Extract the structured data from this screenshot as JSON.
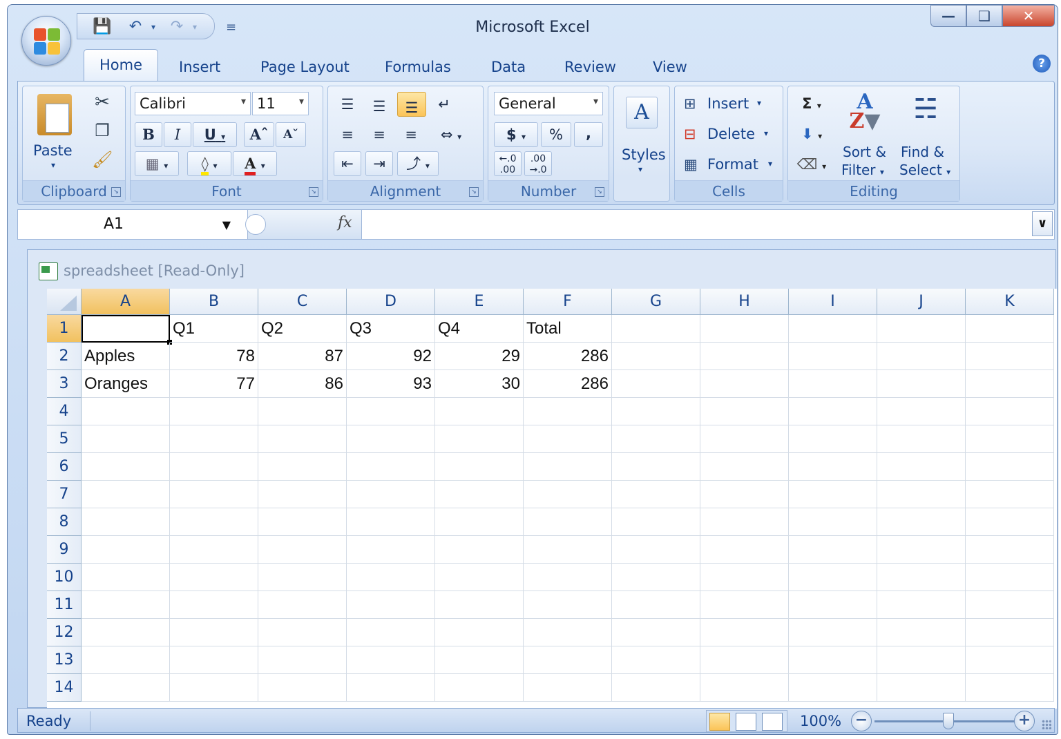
{
  "window": {
    "title": "Microsoft Excel"
  },
  "ribbon_tabs": [
    "Home",
    "Insert",
    "Page Layout",
    "Formulas",
    "Data",
    "Review",
    "View"
  ],
  "ribbon": {
    "clipboard": {
      "label": "Clipboard",
      "paste": "Paste"
    },
    "font": {
      "label": "Font",
      "name": "Calibri",
      "size": "11"
    },
    "alignment": {
      "label": "Alignment"
    },
    "number": {
      "label": "Number",
      "format": "General",
      "currency": "$",
      "percent": "%",
      "comma": ",",
      "inc_decimal": ".00",
      "dec_decimal": ".0"
    },
    "styles": {
      "label": "Styles"
    },
    "cells": {
      "label": "Cells",
      "insert": "Insert",
      "delete": "Delete",
      "format": "Format"
    },
    "editing": {
      "label": "Editing",
      "sort_line1": "Sort &",
      "sort_line2": "Filter",
      "find_line1": "Find &",
      "find_line2": "Select"
    }
  },
  "formula_bar": {
    "name_box": "A1",
    "fx": "fx",
    "value": ""
  },
  "workbook": {
    "title": "spreadsheet  [Read-Only]"
  },
  "sheet": {
    "columns": [
      "A",
      "B",
      "C",
      "D",
      "E",
      "F",
      "G",
      "H",
      "I",
      "J",
      "K"
    ],
    "rows": [
      "1",
      "2",
      "3",
      "4",
      "5",
      "6",
      "7",
      "8",
      "9",
      "10",
      "11",
      "12",
      "13",
      "14"
    ],
    "active_cell": "A1",
    "data": [
      [
        "",
        "Q1",
        "Q2",
        "Q3",
        "Q4",
        "Total"
      ],
      [
        "Apples",
        "78",
        "87",
        "92",
        "29",
        "286"
      ],
      [
        "Oranges",
        "77",
        "86",
        "93",
        "30",
        "286"
      ]
    ]
  },
  "status": {
    "mode": "Ready",
    "zoom": "100%",
    "zoom_level": 1.0
  },
  "colors": {
    "accent": "#15428b",
    "selected_header": "#f1c15f",
    "ribbon_bg": "#dbe7f7"
  }
}
